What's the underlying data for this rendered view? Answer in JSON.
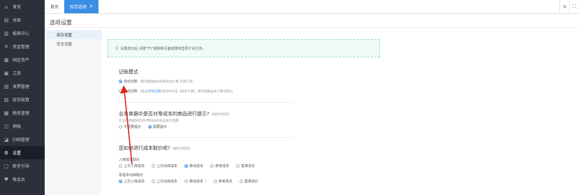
{
  "sidebar": {
    "items": [
      {
        "icon": "home-icon",
        "glyph": "⌂",
        "label": "首页"
      },
      {
        "icon": "overview-icon",
        "glyph": "▤",
        "label": "总账"
      },
      {
        "icon": "report-icon",
        "glyph": "▥",
        "label": "报表中心"
      },
      {
        "icon": "fund-icon",
        "glyph": "¥",
        "label": "资金管理"
      },
      {
        "icon": "asset-icon",
        "glyph": "▦",
        "label": "固定资产"
      },
      {
        "icon": "salary-icon",
        "glyph": "▣",
        "label": "工资"
      },
      {
        "icon": "invoice-icon",
        "glyph": "▧",
        "label": "发票管理"
      },
      {
        "icon": "inventory-icon",
        "glyph": "▨",
        "label": "库存核算"
      },
      {
        "icon": "tax-icon",
        "glyph": "▩",
        "label": "税务管理"
      },
      {
        "icon": "sales-icon",
        "glyph": "◫",
        "label": "销账"
      },
      {
        "icon": "archive-icon",
        "glyph": "◪",
        "label": "归档管理"
      },
      {
        "icon": "settings-icon",
        "glyph": "⚙",
        "label": "设置"
      },
      {
        "icon": "guide-icon",
        "glyph": "▢",
        "label": "新手引导"
      },
      {
        "icon": "accountant-icon",
        "glyph": "♥",
        "label": "帐会员"
      }
    ],
    "active_index": 11
  },
  "tabs": [
    {
      "label": "首页"
    },
    {
      "label": "库存选项"
    }
  ],
  "page_title": "选项设置",
  "subnav": [
    "库存设置",
    "安全设置"
  ],
  "tip": "设置成功后,请按\"F5\"键刷新页面或重新登录才会生效。",
  "mode": {
    "title": "记账模式",
    "auto_label": "自动记账",
    "auto_hint": "(库存数据由本系统总动计算,无需干预)",
    "manual_label": "手动记账",
    "manual_hint_pre": "(通过",
    "manual_link": "[手动记账]",
    "manual_hint_post": "按钮中点击【成本计算】,库存数据由本计算(结账))"
  },
  "zero_cost": {
    "title": "业务单据中是否对零成本的商品进行提示?",
    "title_sub": "(随时可修改)",
    "note": "在业务单据保存时对零成本的商品进行提醒",
    "options": [
      "不需要提示",
      "需要提示"
    ],
    "selected": 1
  },
  "cost_price": {
    "title": "您如何进行成本取价呢?",
    "title_sub": "(随时可修改)",
    "in_label": "入库成本取价",
    "in_options": [
      "上次入库成本",
      "上次出库成本",
      "移动成本",
      "参考成本",
      "基准进价"
    ],
    "in_selected": 2,
    "out_label": "零成本出库取价",
    "out_options": [
      "上次入库成本",
      "上次出库成本",
      "移动成本",
      "参考成本",
      "基准进价"
    ],
    "out_selected": 0,
    "out_help": "?"
  }
}
